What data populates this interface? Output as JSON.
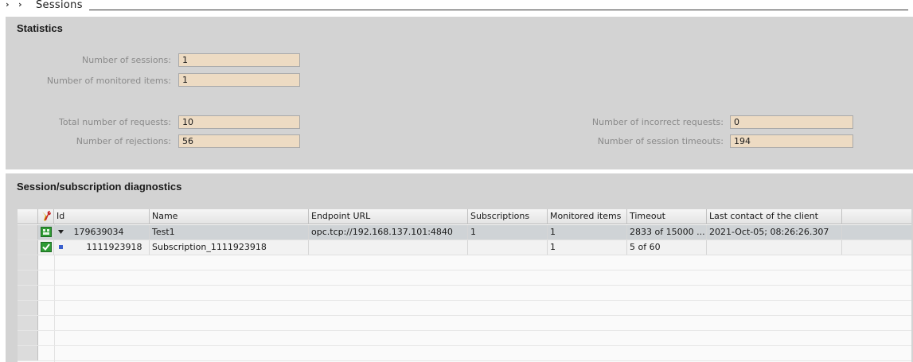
{
  "breadcrumb": {
    "chevrons": [
      "›",
      "›"
    ],
    "title": "Sessions"
  },
  "statistics": {
    "title": "Statistics",
    "number_of_sessions": {
      "label": "Number of sessions:",
      "value": "1"
    },
    "number_of_monitored_items": {
      "label": "Number of monitored items:",
      "value": "1"
    },
    "total_number_of_requests": {
      "label": "Total number of requests:",
      "value": "10"
    },
    "number_of_rejections": {
      "label": "Number of rejections:",
      "value": "56"
    },
    "number_of_incorrect_requests": {
      "label": "Number of incorrect requests:",
      "value": "0"
    },
    "number_of_session_timeouts": {
      "label": "Number of session timeouts:",
      "value": "194"
    }
  },
  "diagnostics": {
    "title": "Session/subscription diagnostics",
    "columns": [
      "Id",
      "Name",
      "Endpoint URL",
      "Subscriptions",
      "Monitored items",
      "Timeout",
      "Last contact of the client"
    ],
    "rows": [
      {
        "status_icon": "session-status-icon",
        "expander": "expanded-triangle-icon",
        "id": "179639034",
        "name": "Test1",
        "endpoint_url": "opc.tcp://192.168.137.101:4840",
        "subscriptions": "1",
        "monitored_items": "1",
        "timeout": "2833 of 15000 ...",
        "last_contact": "2021-Oct-05; 08:26:26.307"
      },
      {
        "status_icon": "check-status-icon",
        "expander": "subscription-node-icon",
        "id": "1111923918",
        "name": "Subscription_1111923918",
        "endpoint_url": "",
        "subscriptions": "",
        "monitored_items": "1",
        "timeout": "5 of 60",
        "last_contact": ""
      }
    ]
  },
  "colors": {
    "panel_bg": "#d3d3d3",
    "field_bg": "#eddbc3",
    "selected_row": "#cfd3d6",
    "status_green": "#2e9b34"
  }
}
